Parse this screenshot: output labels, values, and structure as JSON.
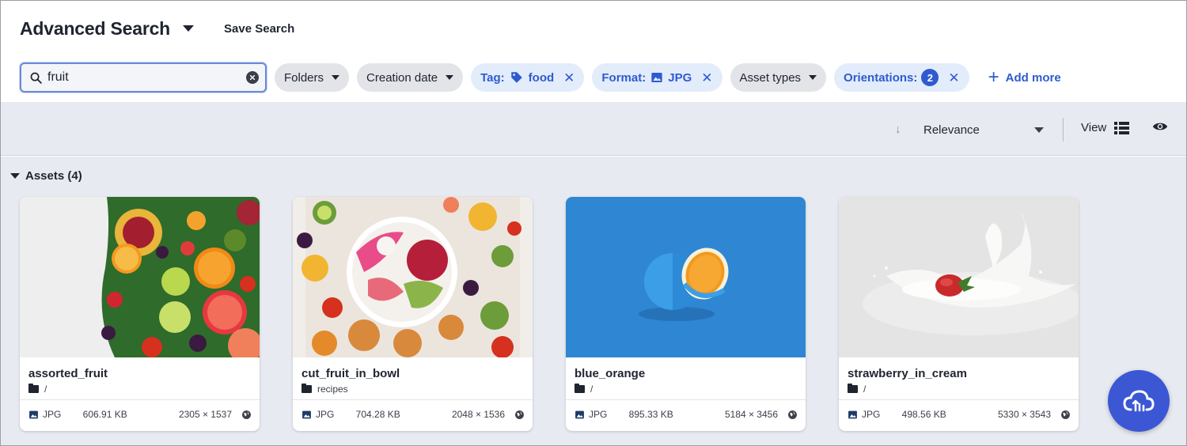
{
  "header": {
    "title": "Advanced Search",
    "save_search_label": "Save Search"
  },
  "search": {
    "value": "fruit",
    "placeholder": ""
  },
  "filters": [
    {
      "kind": "dropdown",
      "label": "Folders"
    },
    {
      "kind": "dropdown",
      "label": "Creation date"
    },
    {
      "kind": "active",
      "label": "Tag:",
      "value": "food",
      "icon": "tag-icon"
    },
    {
      "kind": "active",
      "label": "Format:",
      "value": "JPG",
      "icon": "image-icon"
    },
    {
      "kind": "dropdown",
      "label": "Asset types"
    },
    {
      "kind": "active",
      "label": "Orientations:",
      "count": "2"
    }
  ],
  "add_more_label": "Add more",
  "toolbar": {
    "sort_label": "Relevance",
    "view_label": "View"
  },
  "assets": {
    "heading": "Assets (4)",
    "items": [
      {
        "name": "assorted_fruit",
        "folder": "/",
        "format": "JPG",
        "size": "606.91 KB",
        "dimensions": "2305 × 1537"
      },
      {
        "name": "cut_fruit_in_bowl",
        "folder": "recipes",
        "format": "JPG",
        "size": "704.28 KB",
        "dimensions": "2048 × 1536"
      },
      {
        "name": "blue_orange",
        "folder": "/",
        "format": "JPG",
        "size": "895.33 KB",
        "dimensions": "5184 × 3456"
      },
      {
        "name": "strawberry_in_cream",
        "folder": "/",
        "format": "JPG",
        "size": "498.56 KB",
        "dimensions": "5330 × 3543"
      }
    ]
  },
  "colors": {
    "accent": "#2f5bd0",
    "fab": "#3b57d4",
    "toolbar_bg": "#e7eaf0"
  }
}
